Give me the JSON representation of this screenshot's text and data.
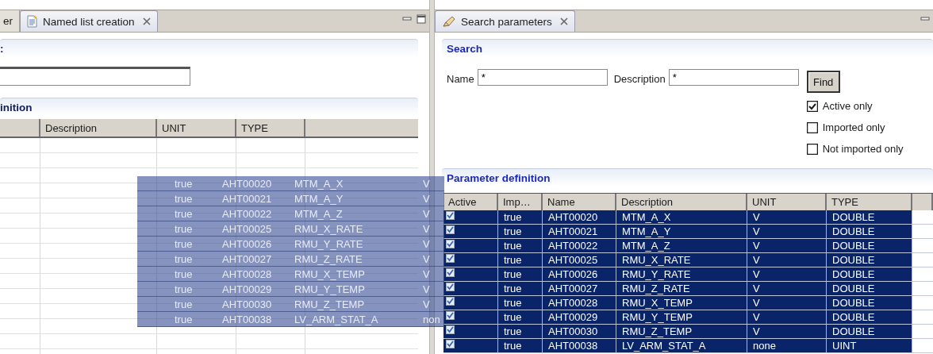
{
  "left_panel": {
    "tabs": [
      {
        "label": "er",
        "selected": false
      },
      {
        "label": "Named list creation",
        "selected": true
      }
    ],
    "section_title": ":",
    "definition_title": "inition",
    "columns": [
      "Description",
      "UNIT",
      "TYPE"
    ]
  },
  "drag_preview": {
    "rows": [
      {
        "imported": "true",
        "name": "AHT00020",
        "description": "MTM_A_X",
        "unit": "V"
      },
      {
        "imported": "true",
        "name": "AHT00021",
        "description": "MTM_A_Y",
        "unit": "V"
      },
      {
        "imported": "true",
        "name": "AHT00022",
        "description": "MTM_A_Z",
        "unit": "V"
      },
      {
        "imported": "true",
        "name": "AHT00025",
        "description": "RMU_X_RATE",
        "unit": "V"
      },
      {
        "imported": "true",
        "name": "AHT00026",
        "description": "RMU_Y_RATE",
        "unit": "V"
      },
      {
        "imported": "true",
        "name": "AHT00027",
        "description": "RMU_Z_RATE",
        "unit": "V"
      },
      {
        "imported": "true",
        "name": "AHT00028",
        "description": "RMU_X_TEMP",
        "unit": "V"
      },
      {
        "imported": "true",
        "name": "AHT00029",
        "description": "RMU_Y_TEMP",
        "unit": "V"
      },
      {
        "imported": "true",
        "name": "AHT00030",
        "description": "RMU_Z_TEMP",
        "unit": "V"
      },
      {
        "imported": "true",
        "name": "AHT00038",
        "description": "LV_ARM_STAT_A",
        "unit": "non"
      }
    ]
  },
  "right_panel": {
    "tab": {
      "label": "Search parameters",
      "selected": true
    },
    "search": {
      "title": "Search",
      "name_label": "Name",
      "name_value": "*",
      "description_label": "Description",
      "description_value": "*",
      "find_button": "Find",
      "options": [
        {
          "label": "Active only",
          "checked": true
        },
        {
          "label": "Imported only",
          "checked": false
        },
        {
          "label": "Not imported only",
          "checked": false
        }
      ]
    },
    "parameters": {
      "title": "Parameter definition",
      "columns": [
        "Active",
        "Imp…",
        "Name",
        "Description",
        "UNIT",
        "TYPE"
      ],
      "rows": [
        {
          "active": true,
          "imported": "true",
          "name": "AHT00020",
          "description": "MTM_A_X",
          "unit": "V",
          "type": "DOUBLE",
          "selected": true
        },
        {
          "active": true,
          "imported": "true",
          "name": "AHT00021",
          "description": "MTM_A_Y",
          "unit": "V",
          "type": "DOUBLE",
          "selected": true
        },
        {
          "active": true,
          "imported": "true",
          "name": "AHT00022",
          "description": "MTM_A_Z",
          "unit": "V",
          "type": "DOUBLE",
          "selected": true
        },
        {
          "active": true,
          "imported": "true",
          "name": "AHT00025",
          "description": "RMU_X_RATE",
          "unit": "V",
          "type": "DOUBLE",
          "selected": true
        },
        {
          "active": true,
          "imported": "true",
          "name": "AHT00026",
          "description": "RMU_Y_RATE",
          "unit": "V",
          "type": "DOUBLE",
          "selected": true
        },
        {
          "active": true,
          "imported": "true",
          "name": "AHT00027",
          "description": "RMU_Z_RATE",
          "unit": "V",
          "type": "DOUBLE",
          "selected": true
        },
        {
          "active": true,
          "imported": "true",
          "name": "AHT00028",
          "description": "RMU_X_TEMP",
          "unit": "V",
          "type": "DOUBLE",
          "selected": true
        },
        {
          "active": true,
          "imported": "true",
          "name": "AHT00029",
          "description": "RMU_Y_TEMP",
          "unit": "V",
          "type": "DOUBLE",
          "selected": true
        },
        {
          "active": true,
          "imported": "true",
          "name": "AHT00030",
          "description": "RMU_Z_TEMP",
          "unit": "V",
          "type": "DOUBLE",
          "selected": true
        },
        {
          "active": true,
          "imported": "true",
          "name": "AHT00038",
          "description": "LV_ARM_STAT_A",
          "unit": "none",
          "type": "UINT",
          "selected": true
        }
      ]
    }
  }
}
